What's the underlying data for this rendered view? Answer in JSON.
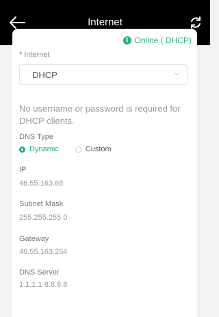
{
  "header": {
    "title": "Internet",
    "background": "#000000"
  },
  "status": {
    "text": "Online ( DHCP)",
    "color": "#2dac84",
    "icon": "info-icon"
  },
  "form": {
    "internet_label": "Internet",
    "required_mark": "*",
    "internet_value": "DHCP",
    "hint": "No username or password is required for DHCP clients.",
    "dns_type_label": "DNS Type",
    "dns_options": [
      "Dynamic",
      "Custom"
    ],
    "dns_selected": "Dynamic"
  },
  "details": {
    "ip_label": "IP",
    "ip_value": "46.55.163.68",
    "subnet_label": "Subnet Mask",
    "subnet_value": "255.255.255.0",
    "gateway_label": "Gateway",
    "gateway_value": "46.55.163.254",
    "dns_server_label": "DNS Server",
    "dns_server_value": "1.1.1.1 8.8.8.8"
  }
}
